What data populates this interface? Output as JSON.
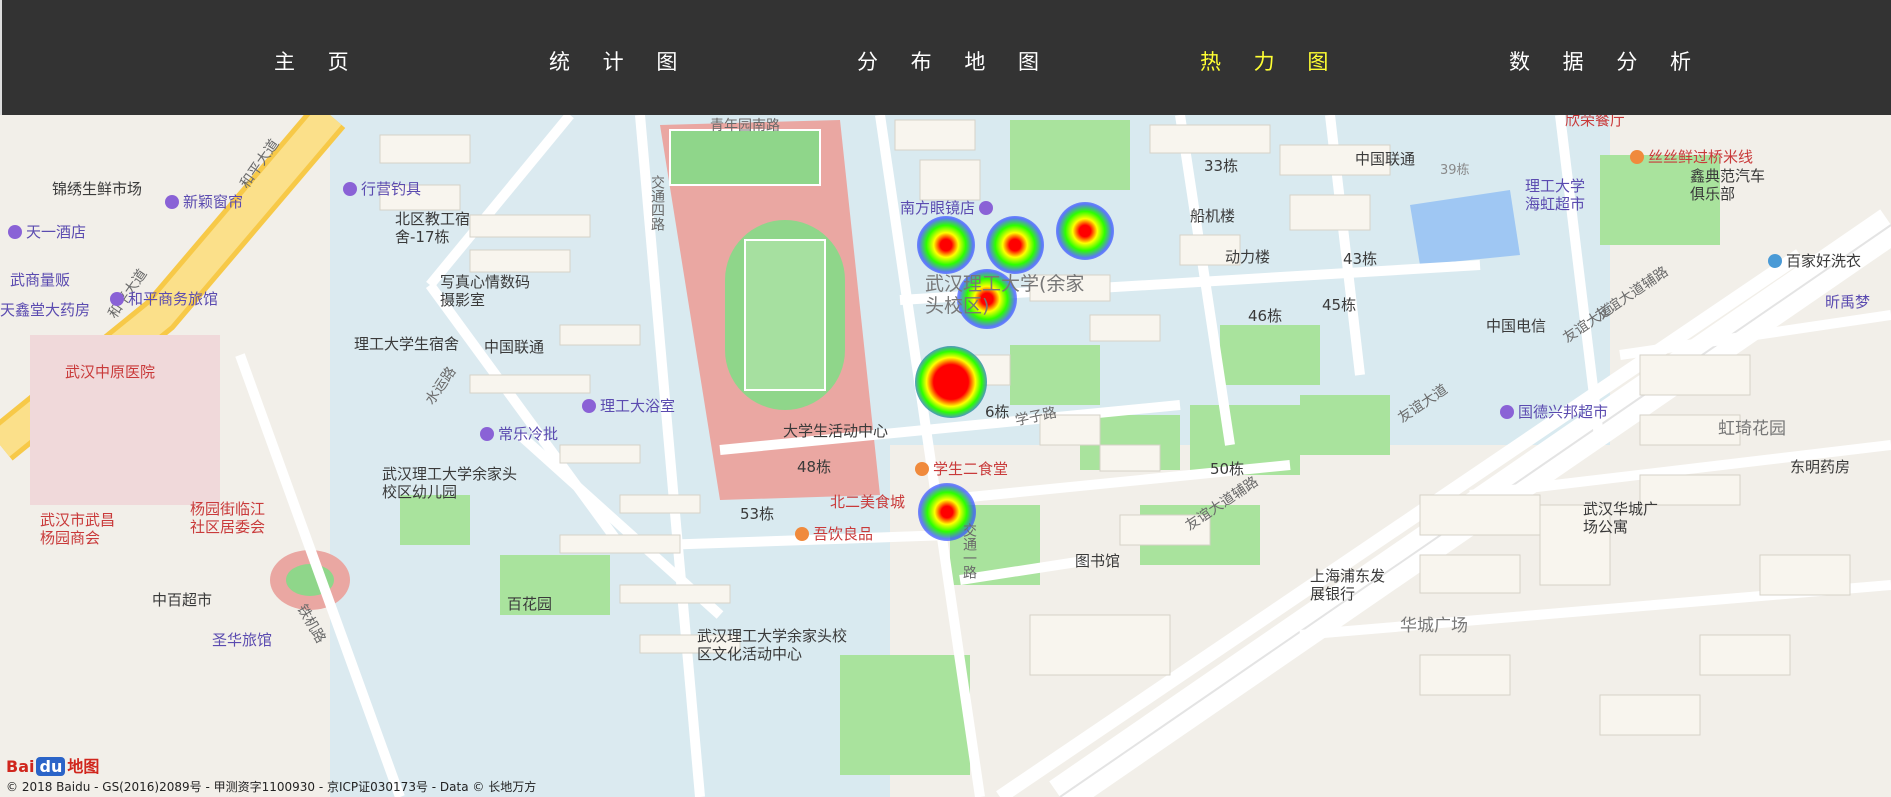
{
  "nav": {
    "items": [
      {
        "label": "主 页"
      },
      {
        "label": "统 计 图"
      },
      {
        "label": "分 布 地 图"
      },
      {
        "label": "热 力 图",
        "active": true
      },
      {
        "label": "数 据 分 析"
      }
    ],
    "background": "#333333",
    "active_color": "#ffff33"
  },
  "map": {
    "labels": {
      "qingnianyuan_road": "青年园南路",
      "xinyuan": "欣荣餐厅",
      "siliu": "丝丝鲜过桥米线",
      "hepingdadao": "和平大道",
      "hepingdadao2": "和平大道",
      "jinxiu": "锦绣生鲜市场",
      "xinying": "新颖窗帘",
      "xingying": "行营钓具",
      "beiqu_dorm": "北区教工宿舍-17栋",
      "jiaotong4": "交通四路",
      "nanfang_glasses": "南方眼镜店",
      "dorm33": "33栋",
      "zhongguo_liantong1": "中国联通",
      "dorm39": "39栋",
      "ligong_supermarket": "理工大学海虹超市",
      "xindian_auto": "鑫典范汽车俱乐部",
      "tianyi_hotel": "天一酒店",
      "wushang": "武商量贩",
      "heping_hotel": "和平商务旅馆",
      "tianxintang": "天鑫堂大药房",
      "xiezhen": "写真心情数码摄影室",
      "whut": "武汉理工大学(余家头校区)",
      "chuanjilou": "船机楼",
      "donglilou": "动力楼",
      "dorm43": "43栋",
      "dorm45": "45栋",
      "dorm46": "46栋",
      "baijiahao": "百家好洗衣",
      "xinmeng": "昕禹梦",
      "wuhan_zhongyuan": "武汉中原医院",
      "ligong_dorm": "理工大学生宿舍",
      "zhongguo_liantong2": "中国联通",
      "zhongguo_dianxin": "中国电信",
      "youyi_aux": "友谊大道辅路",
      "youyi_road": "友谊大道",
      "shuiyun": "水运路",
      "ligong_bath": "理工大浴室",
      "changle": "常乐冷批",
      "student_center": "大学生活动中心",
      "dorm6": "6栋",
      "xuezi_road": "学子路",
      "guodexing": "国德兴邦超市",
      "honghuayuan": "虹琦花园",
      "dongming": "东明药房",
      "kindergarten": "武汉理工大学余家头校区幼儿园",
      "dorm48": "48栋",
      "canteen2": "学生二食堂",
      "dorm50": "50栋",
      "youyi_aux2": "友谊大道辅路",
      "youyi_road2": "友谊大道",
      "yangyuan_linjiang": "杨园街临江社区居委会",
      "wuchang_yangyuan": "武汉市武昌杨园商会",
      "beier": "北二美食城",
      "dorm53": "53栋",
      "wuyin": "吾饮良品",
      "jiaotong1": "交通一路",
      "library": "图书馆",
      "wuhan_huacheng": "武汉华城广场公寓",
      "zhongbai": "中百超市",
      "baihuayuan": "百花园",
      "shanghai_pudong": "上海浦东发展银行",
      "huacheng_square": "华城广场",
      "shenghua": "圣华旅馆",
      "culture_center": "武汉理工大学余家头校区文化活动中心",
      "tiejin": "铁机路"
    },
    "heat_points_note": "",
    "credit": "© 2018 Baidu - GS(2016)2089号 - 甲测资字1100930 - 京ICP证030173号 - Data © 长地万方",
    "logo_text": "Bai",
    "logo_mid": "du",
    "logo_tail": "地图"
  }
}
